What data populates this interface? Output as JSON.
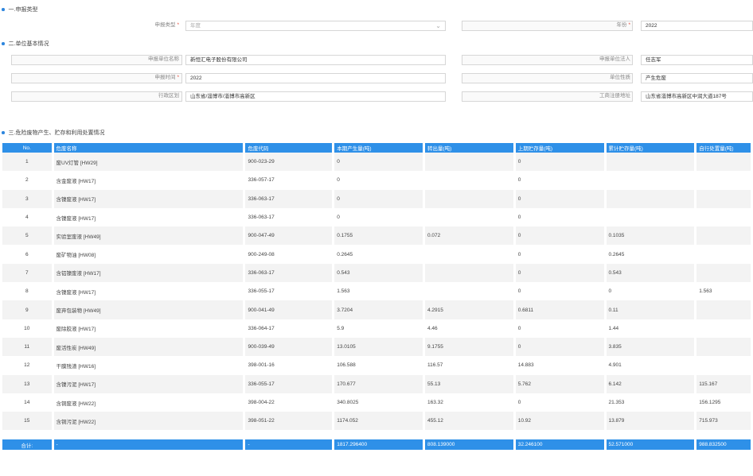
{
  "sections": {
    "s1": "一.申报类型",
    "s2": "二.单位基本情况",
    "s3": "三.危险废物产生、贮存和利用处置情况"
  },
  "type_form": {
    "report_type_label": "申报类型",
    "report_type_placeholder": "年度",
    "year_label": "年份",
    "year_value": "2022"
  },
  "unit_form": {
    "unit_name_label": "申报单位名称",
    "unit_name_value": "新恒汇电子股份有限公司",
    "legal_rep_label": "申报单位法人",
    "legal_rep_value": "任志军",
    "report_time_label": "申报时间",
    "report_time_value": "2022",
    "unit_nature_label": "单位性质",
    "unit_nature_value": "产生危废",
    "district_label": "行政区划",
    "district_value": "山东省/淄博市/淄博市高新区",
    "reg_address_label": "工商注册地址",
    "reg_address_value": "山东省淄博市高新区中润大道187号"
  },
  "required_mark": "*",
  "table": {
    "headers": [
      "No.",
      "危废名称",
      "危废代码",
      "本期产生量(吨)",
      "转出量(吨)",
      "上期贮存量(吨)",
      "累计贮存量(吨)",
      "自行处置量(吨)"
    ],
    "rows": [
      [
        "1",
        "废UV灯管 [HW29]",
        "900-023-29",
        "0",
        "",
        "0",
        "",
        ""
      ],
      [
        "2",
        "含金废液 [HW17]",
        "336-057-17",
        "0",
        "",
        "0",
        "",
        ""
      ],
      [
        "3",
        "含镍废液 [HW17]",
        "336-063-17",
        "0",
        "",
        "0",
        "",
        ""
      ],
      [
        "4",
        "含镍废液 [HW17]",
        "336-063-17",
        "0",
        "",
        "0",
        "",
        ""
      ],
      [
        "5",
        "实验室废液 [HW49]",
        "900-047-49",
        "0.1755",
        "0.072",
        "0",
        "0.1035",
        ""
      ],
      [
        "6",
        "废矿物油 [HW08]",
        "900-249-08",
        "0.2645",
        "",
        "0",
        "0.2645",
        ""
      ],
      [
        "7",
        "含铝镍废液 [HW17]",
        "336-063-17",
        "0.543",
        "",
        "0",
        "0.543",
        ""
      ],
      [
        "8",
        "含镍废液 [HW17]",
        "336-055-17",
        "1.563",
        "",
        "0",
        "0",
        "1.563"
      ],
      [
        "9",
        "废弃包装物 [HW49]",
        "900-041-49",
        "3.7204",
        "4.2915",
        "0.6811",
        "0.11",
        ""
      ],
      [
        "10",
        "废除胶液 [HW17]",
        "336-064-17",
        "5.9",
        "4.46",
        "0",
        "1.44",
        ""
      ],
      [
        "11",
        "废活性炭 [HW49]",
        "900-039-49",
        "13.0105",
        "9.1755",
        "0",
        "3.835",
        ""
      ],
      [
        "12",
        "干膜残渣 [HW16]",
        "398-001-16",
        "106.588",
        "116.57",
        "14.883",
        "4.901",
        ""
      ],
      [
        "13",
        "含镍污泥 [HW17]",
        "336-055-17",
        "170.677",
        "55.13",
        "5.762",
        "6.142",
        "115.167"
      ],
      [
        "14",
        "含铜废液 [HW22]",
        "398-004-22",
        "340.8025",
        "163.32",
        "0",
        "21.353",
        "156.1295"
      ],
      [
        "15",
        "含铜污泥 [HW22]",
        "398-051-22",
        "1174.052",
        "455.12",
        "10.92",
        "13.879",
        "715.973"
      ]
    ],
    "total": [
      "合计:",
      "-",
      "-",
      "1817.296400",
      "808.139000",
      "32.246100",
      "52.571000",
      "988.832500"
    ]
  }
}
